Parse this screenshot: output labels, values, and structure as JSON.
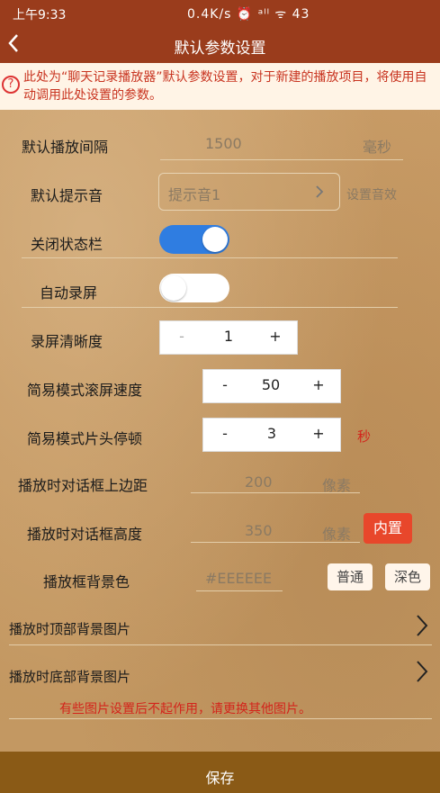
{
  "status": {
    "time": "上午9:33",
    "indicators": "0.4K/s ⏰ ᵃˡˡ ᯤ 43"
  },
  "header": {
    "title": "默认参数设置",
    "back_icon": "chevron-left-icon"
  },
  "notice": {
    "text": "此处为“聊天记录播放器”默认参数设置，对于新建的播放项目，将使用自动调用此处设置的参数。"
  },
  "interval": {
    "label": "默认播放间隔",
    "value": "1500",
    "unit": "毫秒"
  },
  "sound": {
    "label": "默认提示音",
    "value": "提示音1",
    "action": "设置音效"
  },
  "statusbar_toggle": {
    "label": "关闭状态栏",
    "on": true
  },
  "record_toggle": {
    "label": "自动录屏",
    "on": false
  },
  "clarity": {
    "label": "录屏清晰度",
    "minus": "-",
    "value": "1",
    "plus": "+"
  },
  "scroll_speed": {
    "label": "简易模式滚屏速度",
    "minus": "-",
    "value": "50",
    "plus": "+"
  },
  "pause": {
    "label": "简易模式片头停顿",
    "minus": "-",
    "value": "3",
    "plus": "+",
    "unit": "秒"
  },
  "top_margin": {
    "label": "播放时对话框上边距",
    "value": "200",
    "unit": "像素"
  },
  "dialog_height": {
    "label": "播放时对话框高度",
    "value": "350",
    "unit": "像素",
    "builtin": "内置"
  },
  "bg_color": {
    "label": "播放框背景色",
    "value": "#EEEEEE",
    "normal": "普通",
    "dark": "深色"
  },
  "top_image": {
    "label": "播放时顶部背景图片"
  },
  "bottom_image": {
    "label": "播放时底部背景图片"
  },
  "warning": "有些图片设置后不起作用，请更换其他图片。",
  "save": {
    "label": "保存"
  }
}
